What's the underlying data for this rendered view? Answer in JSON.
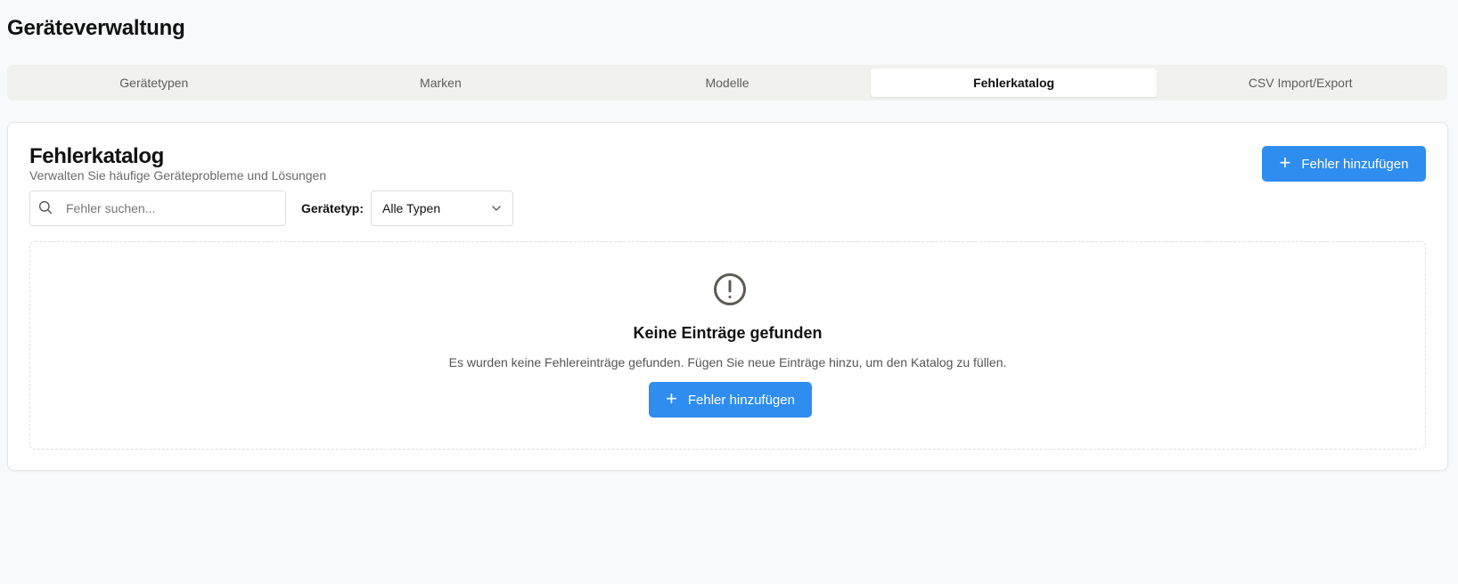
{
  "page": {
    "title": "Geräteverwaltung"
  },
  "tabs": [
    {
      "label": "Gerätetypen",
      "active": false
    },
    {
      "label": "Marken",
      "active": false
    },
    {
      "label": "Modelle",
      "active": false
    },
    {
      "label": "Fehlerkatalog",
      "active": true
    },
    {
      "label": "CSV Import/Export",
      "active": false
    }
  ],
  "card": {
    "title": "Fehlerkatalog",
    "subtitle": "Verwalten Sie häufige Geräteprobleme und Lösungen",
    "add_button_label": "Fehler hinzufügen",
    "add_button_icon": "plus-icon"
  },
  "filters": {
    "search_placeholder": "Fehler suchen...",
    "search_value": "",
    "search_icon": "search-icon",
    "device_type_label": "Gerätetyp:",
    "device_type_selected": "Alle Typen",
    "device_type_icon": "chevron-down-icon"
  },
  "empty_state": {
    "icon": "alert-circle-icon",
    "title": "Keine Einträge gefunden",
    "text": "Es wurden keine Fehlereinträge gefunden. Fügen Sie neue Einträge hinzu, um den Katalog zu füllen.",
    "button_label": "Fehler hinzufügen",
    "button_icon": "plus-icon"
  },
  "colors": {
    "primary": "#2f8def",
    "background": "#f8f9fa",
    "tab_bar": "#f1f1ef"
  }
}
